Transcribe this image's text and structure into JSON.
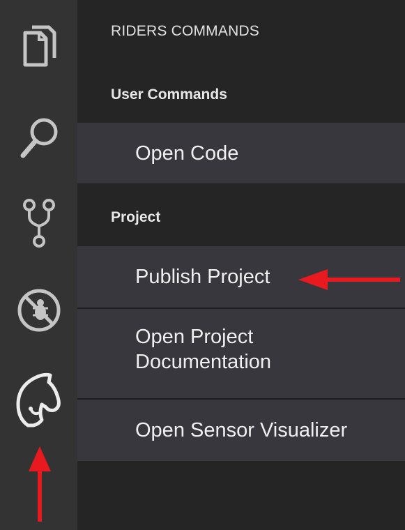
{
  "activity_bar": {
    "icons": [
      "explorer-icon",
      "search-icon",
      "source-control-icon",
      "debug-icon",
      "riders-horse-icon"
    ]
  },
  "panel": {
    "title": "RIDERS COMMANDS",
    "sections": [
      {
        "header": "User Commands",
        "items": [
          "Open Code"
        ]
      },
      {
        "header": "Project",
        "items": [
          "Publish Project",
          "Open Project Documentation",
          "Open Sensor Visualizer"
        ]
      }
    ]
  },
  "two_line_item": {
    "line1": "Open Project",
    "line2": "Documentation"
  },
  "annotations": {
    "arrow_color": "#e8191f"
  },
  "colors": {
    "activity_bar_bg": "#333333",
    "panel_bg": "#252526",
    "item_bg": "#37373d",
    "icon_color": "#c5c5c5"
  }
}
